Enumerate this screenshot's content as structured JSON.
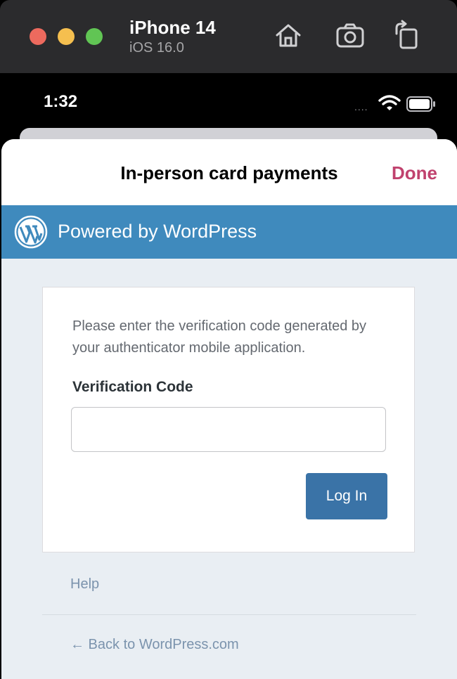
{
  "simulator": {
    "device_name": "iPhone 14",
    "os_version": "iOS 16.0"
  },
  "status_bar": {
    "time": "1:32",
    "signal_dots": "...."
  },
  "nav": {
    "title": "In-person card payments",
    "done_label": "Done"
  },
  "wp_header": {
    "text": "Powered by WordPress"
  },
  "login": {
    "instructions": "Please enter the verification code generated by your authenticator mobile application.",
    "field_label": "Verification Code",
    "field_value": "",
    "button_label": "Log In"
  },
  "links": {
    "help": "Help",
    "back": "← Back to WordPress.com"
  },
  "colors": {
    "accent_done": "#c0426e",
    "wp_blue": "#3f8abd",
    "button_blue": "#3a73a7",
    "link_gray_blue": "#7b93ad"
  }
}
